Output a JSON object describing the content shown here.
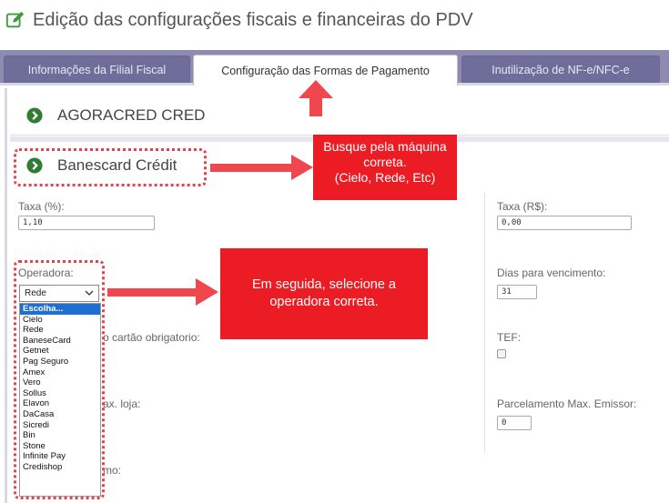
{
  "header": {
    "title": "Edição das configurações fiscais e financeiras do PDV",
    "icon": "edit-icon"
  },
  "tabs": [
    {
      "label": "Informações da Filial Fiscal",
      "active": false
    },
    {
      "label": "Configuração das Formas de Pagamento",
      "active": true
    },
    {
      "label": "Inutilização de NF-e/NFC-e",
      "active": false
    }
  ],
  "sections": [
    {
      "label": "AGORACRED CRED",
      "icon": "chevron-right-circle-icon"
    },
    {
      "label": "Banescard Crédit",
      "icon": "chevron-right-circle-icon"
    }
  ],
  "form": {
    "taxa_pct": {
      "label": "Taxa (%):",
      "value": "1,10"
    },
    "taxa_rs": {
      "label": "Taxa (R$):",
      "value": "0,00"
    },
    "operadora": {
      "label": "Operadora:",
      "selected": "Rede",
      "options": [
        "Escolha...",
        "Cielo",
        "Rede",
        "BaneseCard",
        "Getnet",
        "Pag Seguro",
        "Amex",
        "Vero",
        "Sollus",
        "Elavon",
        "DaCasa",
        "Sicredi",
        "Bin",
        "Stone",
        "Infinite Pay",
        "Credishop"
      ],
      "highlighted": "Escolha..."
    },
    "dias_vencimento": {
      "label": "Dias para vencimento:",
      "value": "31"
    },
    "cartao_obrigatorio": {
      "label": "o cartão obrigatorio:"
    },
    "tef": {
      "label": "TEF:"
    },
    "parcelamento_loja": {
      "label": "ax. loja:"
    },
    "parcelamento_emissor": {
      "label": "Parcelamento Max. Emissor:",
      "value": "0"
    },
    "truncated_label": {
      "label": "mo:"
    }
  },
  "annotations": {
    "callout_machine": [
      "Busque pela máquina",
      "correta.",
      "(Cielo, Rede, Etc)"
    ],
    "callout_operator": [
      "Em seguida, selecione a",
      "operadora correta."
    ]
  },
  "colors": {
    "tab_bar": "#8d8bb0",
    "callout": "#ec1c24",
    "arrow": "#f0464e",
    "accent_green": "#2e9a2e"
  }
}
